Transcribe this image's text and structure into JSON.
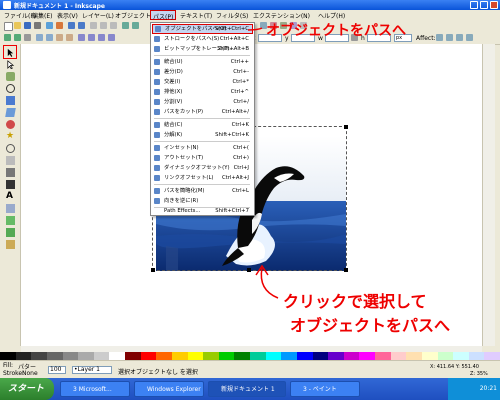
{
  "window": {
    "title": "新規ドキュメント 1 - Inkscape"
  },
  "menubar": {
    "items": [
      "ファイル(F)",
      "編集(E)",
      "表示(V)",
      "レイヤー(L)",
      "オブジェクト(O)",
      "パス(P)",
      "テキスト(T)",
      "フィルタ(S)",
      "エクステンション(N)",
      "ヘルプ(H)"
    ],
    "highlighted": "パス(P)"
  },
  "ctrl": {
    "fields": [
      "x",
      "y",
      "w",
      "h"
    ],
    "unit": "px",
    "affect_label": "Affect:"
  },
  "path_menu": {
    "items": [
      {
        "label": "オブジェクトをパスへ(O)",
        "shortcut": "Shift+Ctrl+C",
        "highlighted": true
      },
      {
        "label": "ストロークをパスへ(S)",
        "shortcut": "Ctrl+Alt+C"
      },
      {
        "label": "ビットマップをトレース(T)...",
        "shortcut": "Shift+Alt+B"
      },
      {
        "label": "統合(U)",
        "shortcut": "Ctrl++"
      },
      {
        "label": "差分(D)",
        "shortcut": "Ctrl+-"
      },
      {
        "label": "交差(I)",
        "shortcut": "Ctrl+*"
      },
      {
        "label": "排他(X)",
        "shortcut": "Ctrl+^"
      },
      {
        "label": "分割(V)",
        "shortcut": "Ctrl+/"
      },
      {
        "label": "パスをカット(P)",
        "shortcut": "Ctrl+Alt+/"
      },
      {
        "label": "結合(C)",
        "shortcut": "Ctrl+K"
      },
      {
        "label": "分解(K)",
        "shortcut": "Shift+Ctrl+K"
      },
      {
        "label": "インセット(N)",
        "shortcut": "Ctrl+("
      },
      {
        "label": "アウトセット(T)",
        "shortcut": "Ctrl+)"
      },
      {
        "label": "ダイナミックオフセット(Y)",
        "shortcut": "Ctrl+J"
      },
      {
        "label": "リンクオフセット(L)",
        "shortcut": "Ctrl+Alt+J"
      },
      {
        "label": "パスを簡略化(M)",
        "shortcut": "Ctrl+L"
      },
      {
        "label": "向きを逆に(R)",
        "shortcut": ""
      },
      {
        "label": "Path Effects...",
        "shortcut": "Shift+Ctrl+7"
      }
    ]
  },
  "annotations": {
    "top": "オブジェクトをパスへ",
    "bottom_line1": "クリックで選択して",
    "bottom_line2": "オブジェクトをパスへ"
  },
  "statusbar": {
    "fill_label": "Fill:",
    "stroke_label": "Stroke:",
    "fill_value": "パター",
    "stroke_value": "None",
    "opacity": "100",
    "layer": "•Layer 1",
    "message": "選択オブジェクトなし を選択",
    "coords": "X: 411.64  Y: 551.40",
    "zoom": "Z: 35%"
  },
  "taskbar": {
    "start": "スタート",
    "items": [
      "3 Microsoft...",
      "Windows Explorer",
      "新規ドキュメント 1",
      "3 - ペイント"
    ],
    "clock": "20:21"
  },
  "colors": {
    "accent_red": "#e00000",
    "xp_blue": "#0a54d9"
  }
}
